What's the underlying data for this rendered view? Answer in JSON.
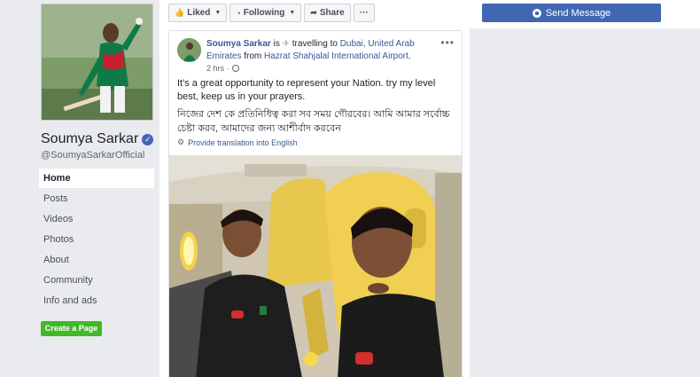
{
  "profile": {
    "name": "Soumya Sarkar",
    "handle": "@SoumyaSarkarOfficial",
    "verified_icon": "verified-badge-icon"
  },
  "sidebar": {
    "items": [
      {
        "label": "Home",
        "active": true
      },
      {
        "label": "Posts",
        "active": false
      },
      {
        "label": "Videos",
        "active": false
      },
      {
        "label": "Photos",
        "active": false
      },
      {
        "label": "About",
        "active": false
      },
      {
        "label": "Community",
        "active": false
      },
      {
        "label": "Info and ads",
        "active": false
      }
    ],
    "create_page_label": "Create a Page"
  },
  "action_bar": {
    "liked_label": "Liked",
    "following_label": "Following",
    "share_label": "Share",
    "more_label": "···"
  },
  "right": {
    "send_message_label": "Send Message"
  },
  "post": {
    "author": "Soumya Sarkar",
    "is_text": " is ",
    "travelling_text": "travelling to ",
    "destination": "Dubai, United Arab Emirates",
    "from_text": " from ",
    "origin": "Hazrat Shahjalal International Airport",
    "period": ".",
    "time": "2 hrs",
    "text_en": "It's a great opportunity to represent your Nation. try my level best, keep us in your prayers.",
    "text_bn": "নিজের দেশ কে প্রতিনিধিত্ব করা সব সময় গৌরবের। আমি আমার সর্বোচ্চ চেষ্টা করব, আমাদের জন্য আশীর্বাদ করবেন",
    "translate_label": "Provide translation into English",
    "more_icon": "•••"
  },
  "colors": {
    "brand_blue": "#4267b2",
    "link_blue": "#365899",
    "create_green": "#42b72a",
    "background": "#e9ebee"
  }
}
